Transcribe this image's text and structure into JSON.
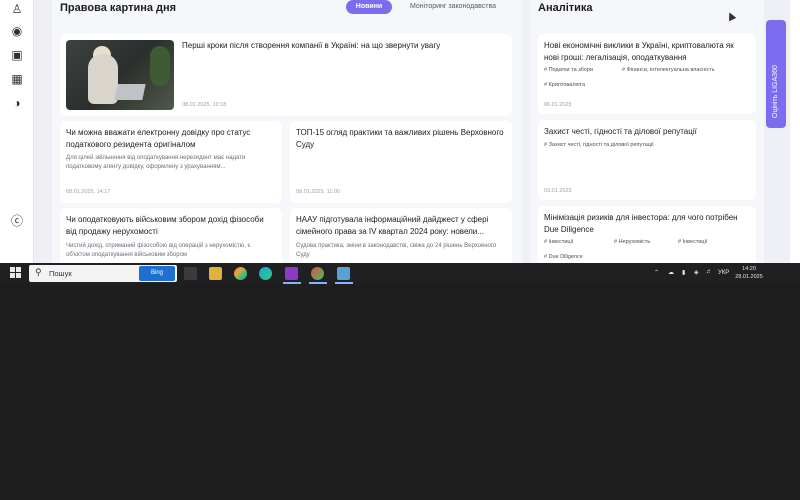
{
  "main": {
    "title": "Правова картина дня",
    "tabs": [
      {
        "label": "Новини",
        "active": true
      },
      {
        "label": "Моніторинг законодавства",
        "active": false
      }
    ],
    "featured": {
      "title": "Перші кроки після створення компанії в Україні: на що звернути увагу",
      "date": "08.01.2025, 10:18"
    },
    "cards": [
      {
        "title": "Чи можна вважати електронну довідку про статус податкового резидента оригіналом",
        "excerpt": "Для цілей звільнення від оподаткування нерезидент має надати податковому агенту довідку, оформлену з урахуванням...",
        "date": "08.01.2025, 14:17"
      },
      {
        "title": "ТОП-15 огляд практики та важливих рішень Верховного Суду",
        "excerpt": "",
        "date": "08.01.2025, 11:00"
      },
      {
        "title": "Чи оподатковують військовим збором дохід фізособи від продажу нерухомості",
        "excerpt": "Чистий дохід, отриманий фізособою від операцій з нерухомістю, є об'єктом оподаткування військовим збором",
        "date": ""
      },
      {
        "title": "НААУ підготувала інформаційний дайджест у сфері сімейного права за IV квартал 2024 року: новели...",
        "excerpt": "Судова практика, зміни в законодавстві, свіжа до 24 рішень Верховного Суду",
        "date": ""
      }
    ]
  },
  "side": {
    "title": "Аналітика",
    "cards": [
      {
        "title": "Нові економічні виклики в Україні, криптовалюта як нові гроші: легалізація, оподаткування",
        "tags": [
          "Податки та збори",
          "Фінанси, інтелектуальна власність",
          "Криптовалюта"
        ],
        "date": "06.01.2025"
      },
      {
        "title": "Захист честі, гідності та ділової репутації",
        "tags": [
          "Захист честі, гідності та ділової репутації"
        ],
        "date": "03.01.2025"
      },
      {
        "title": "Мінімізація ризиків для інвестора: для чого потрібен Due Diligence",
        "tags": [
          "Інвестиції",
          "Нерухомість",
          "Інвестиції",
          "Due Diligence"
        ],
        "date": ""
      }
    ]
  },
  "feedback": {
    "label": "Оцініть LIGA360"
  },
  "taskbar": {
    "search_placeholder": "Пошук",
    "search_promo": "Bing",
    "language": "УКР",
    "time": "14:20",
    "date": "28.01.2025"
  },
  "colors": {
    "accent": "#7b6cf0",
    "taskbar": "#202023",
    "page_bg": "#eef0f5"
  }
}
